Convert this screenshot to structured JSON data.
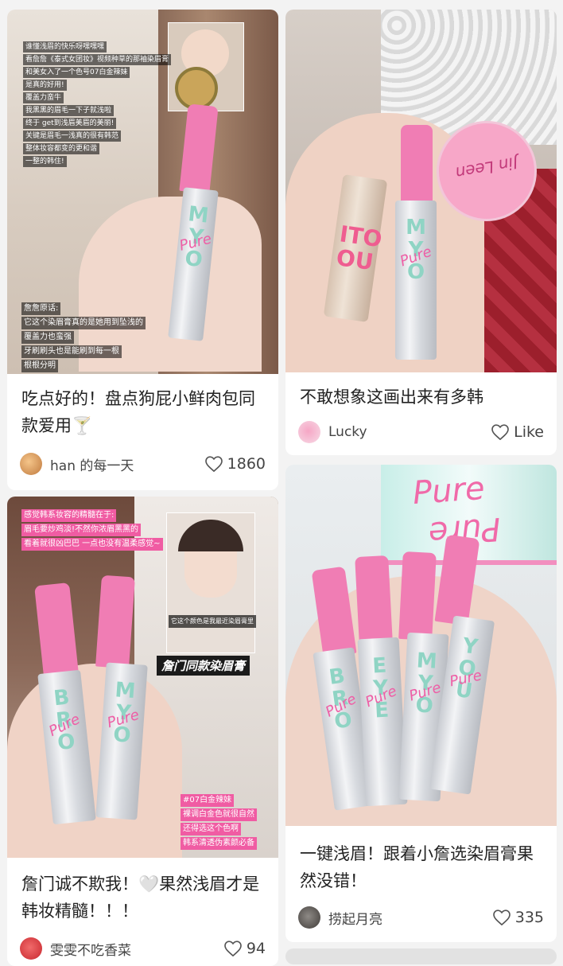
{
  "cards": [
    {
      "title": "吃点好的！盘点狗屁小鲜肉包同款爱用🍸",
      "author": "han 的每一天",
      "likes": "1860",
      "overlay_lines": [
        "谁懂浅眉的快乐呀嘿嘿嘿",
        "看詹詹《泰式女团妆》视频种草的那袖染眉膏",
        "和美女入了一个色号07白金辣妹",
        "是真的好用!",
        "覆盖力蛮牛",
        "我黑黑的眉毛一下子就浅啦",
        "终于 get到浅眉美眉的美丽!",
        "关键是眉毛一浅真的很有韩范",
        "整体妆容都变的更和谐",
        "一整的韩住!"
      ],
      "caption_lines": [
        "詹詹原话:",
        "它这个染眉膏真的是她用到坠浅的",
        "覆盖力也蛮强",
        "牙刷刷头也是能刷到每一根",
        "根根分明"
      ]
    },
    {
      "title": "不敢想象这画出来有多韩",
      "author": "Lucky",
      "likes": "Like"
    },
    {
      "title": "詹门诚不欺我！🤍果然浅眉才是韩妆精髓！！！",
      "author": "雯雯不吃香菜",
      "likes": "94",
      "overlay_lines": [
        "感觉韩系妆容的精髓在于:",
        "眉毛要炒鸡淡!不然你浓眉黑黑的",
        "看着就很凶巴巴 一点也没有温柔感觉~"
      ],
      "video_caption": "它这个颜色是我最近染眉膏里",
      "video_tag": "詹门同款染眉膏",
      "shade_lines": [
        "#07白金辣妹",
        "裸调白金色就很自然",
        "还得选这个色啊",
        "韩系清透伪素颜必备"
      ]
    },
    {
      "title": "一键浅眉！跟着小詹选染眉膏果然没错！",
      "author": "捞起月亮",
      "likes": "335"
    }
  ],
  "icons": {
    "like": "heart-outline-icon"
  },
  "colors": {
    "background": "#f3f3f3",
    "accent_pink": "#f07db4"
  }
}
